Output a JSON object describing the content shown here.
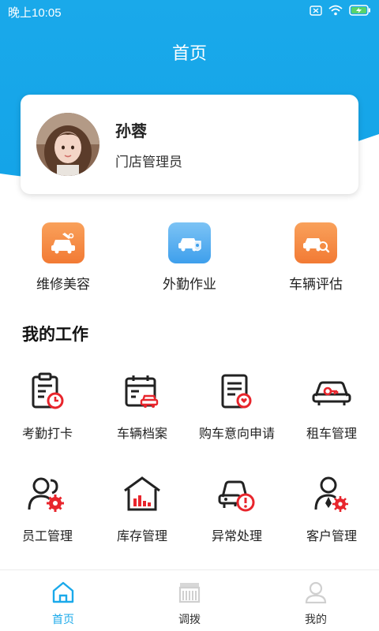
{
  "status_bar": {
    "time": "晚上10:05"
  },
  "header": {
    "title": "首页"
  },
  "profile": {
    "name": "孙蓉",
    "role": "门店管理员"
  },
  "quick_actions": [
    {
      "label": "维修美容",
      "icon": "car-repair-icon"
    },
    {
      "label": "外勤作业",
      "icon": "field-work-car-icon"
    },
    {
      "label": "车辆评估",
      "icon": "car-assessment-icon"
    }
  ],
  "work_section": {
    "title": "我的工作"
  },
  "work_items": [
    {
      "label": "考勤打卡",
      "icon": "attendance-clipboard-icon"
    },
    {
      "label": "车辆档案",
      "icon": "vehicle-archive-calendar-icon"
    },
    {
      "label": "购车意向申请",
      "icon": "purchase-intent-document-icon"
    },
    {
      "label": "租车管理",
      "icon": "car-rental-key-icon"
    },
    {
      "label": "员工管理",
      "icon": "staff-management-icon"
    },
    {
      "label": "库存管理",
      "icon": "inventory-warehouse-icon"
    },
    {
      "label": "异常处理",
      "icon": "exception-car-alert-icon"
    },
    {
      "label": "客户管理",
      "icon": "customer-management-icon"
    }
  ],
  "bottom_nav": [
    {
      "label": "首页",
      "icon": "home-icon",
      "active": true
    },
    {
      "label": "调拨",
      "icon": "transfer-store-icon",
      "active": false
    },
    {
      "label": "我的",
      "icon": "profile-user-icon",
      "active": false
    }
  ],
  "colors": {
    "accent": "#1aa9ea",
    "orange": "#f6813a",
    "blue_light": "#4aa8ee",
    "red": "#e8252c"
  }
}
